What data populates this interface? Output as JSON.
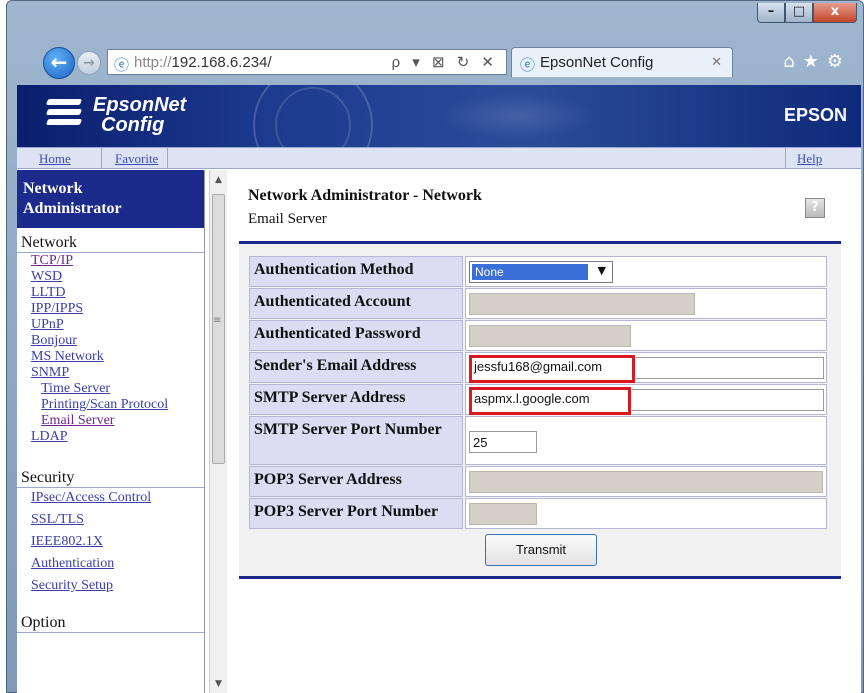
{
  "browser": {
    "address_url_dim": "http://",
    "address_url_host": "192.168.6.234/",
    "address_tools": "ρ ▾ ⊠ ↻ ✕",
    "tab_title": "EpsonNet Config",
    "window_controls": [
      "–",
      "□",
      "x"
    ]
  },
  "header": {
    "brand_line1": "EpsonNet",
    "brand_line2": "Config",
    "epson_logo": "EPSON"
  },
  "linkbar": {
    "home": "Home",
    "favorite": "Favorite",
    "help": "Help"
  },
  "sidebar": {
    "heading_line1": "Network",
    "heading_line2": "Administrator",
    "network_title": "Network",
    "network_items": [
      "TCP/IP",
      "WSD",
      "LLTD",
      "IPP/IPPS",
      "UPnP",
      "Bonjour",
      "MS Network",
      "SNMP",
      "Time Server",
      "Printing/Scan Protocol",
      "Email Server",
      "LDAP"
    ],
    "security_title": "Security",
    "security_items": [
      "IPsec/Access Control",
      "SSL/TLS",
      "IEEE802.1X",
      "Authentication",
      "Security Setup"
    ],
    "option_title": "Option"
  },
  "main": {
    "title": "Network Administrator - Network",
    "subtitle": "Email Server",
    "help_icon": "?",
    "fields": [
      {
        "label": "Authentication Method",
        "value": "None"
      },
      {
        "label": "Authenticated Account",
        "value": ""
      },
      {
        "label": "Authenticated Password",
        "value": ""
      },
      {
        "label": "Sender's Email Address",
        "value": "jessfu168@gmail.com"
      },
      {
        "label": "SMTP Server Address",
        "value": "aspmx.l.google.com"
      },
      {
        "label": "SMTP Server Port Number",
        "value": "25"
      },
      {
        "label": "POP3 Server Address",
        "value": ""
      },
      {
        "label": "POP3 Server Port Number",
        "value": ""
      }
    ],
    "transmit_label": "Transmit"
  },
  "colors": {
    "accent_navy": "#1c2a8c",
    "highlight_red": "#d9191f",
    "link_blue": "#3a3fa6"
  }
}
